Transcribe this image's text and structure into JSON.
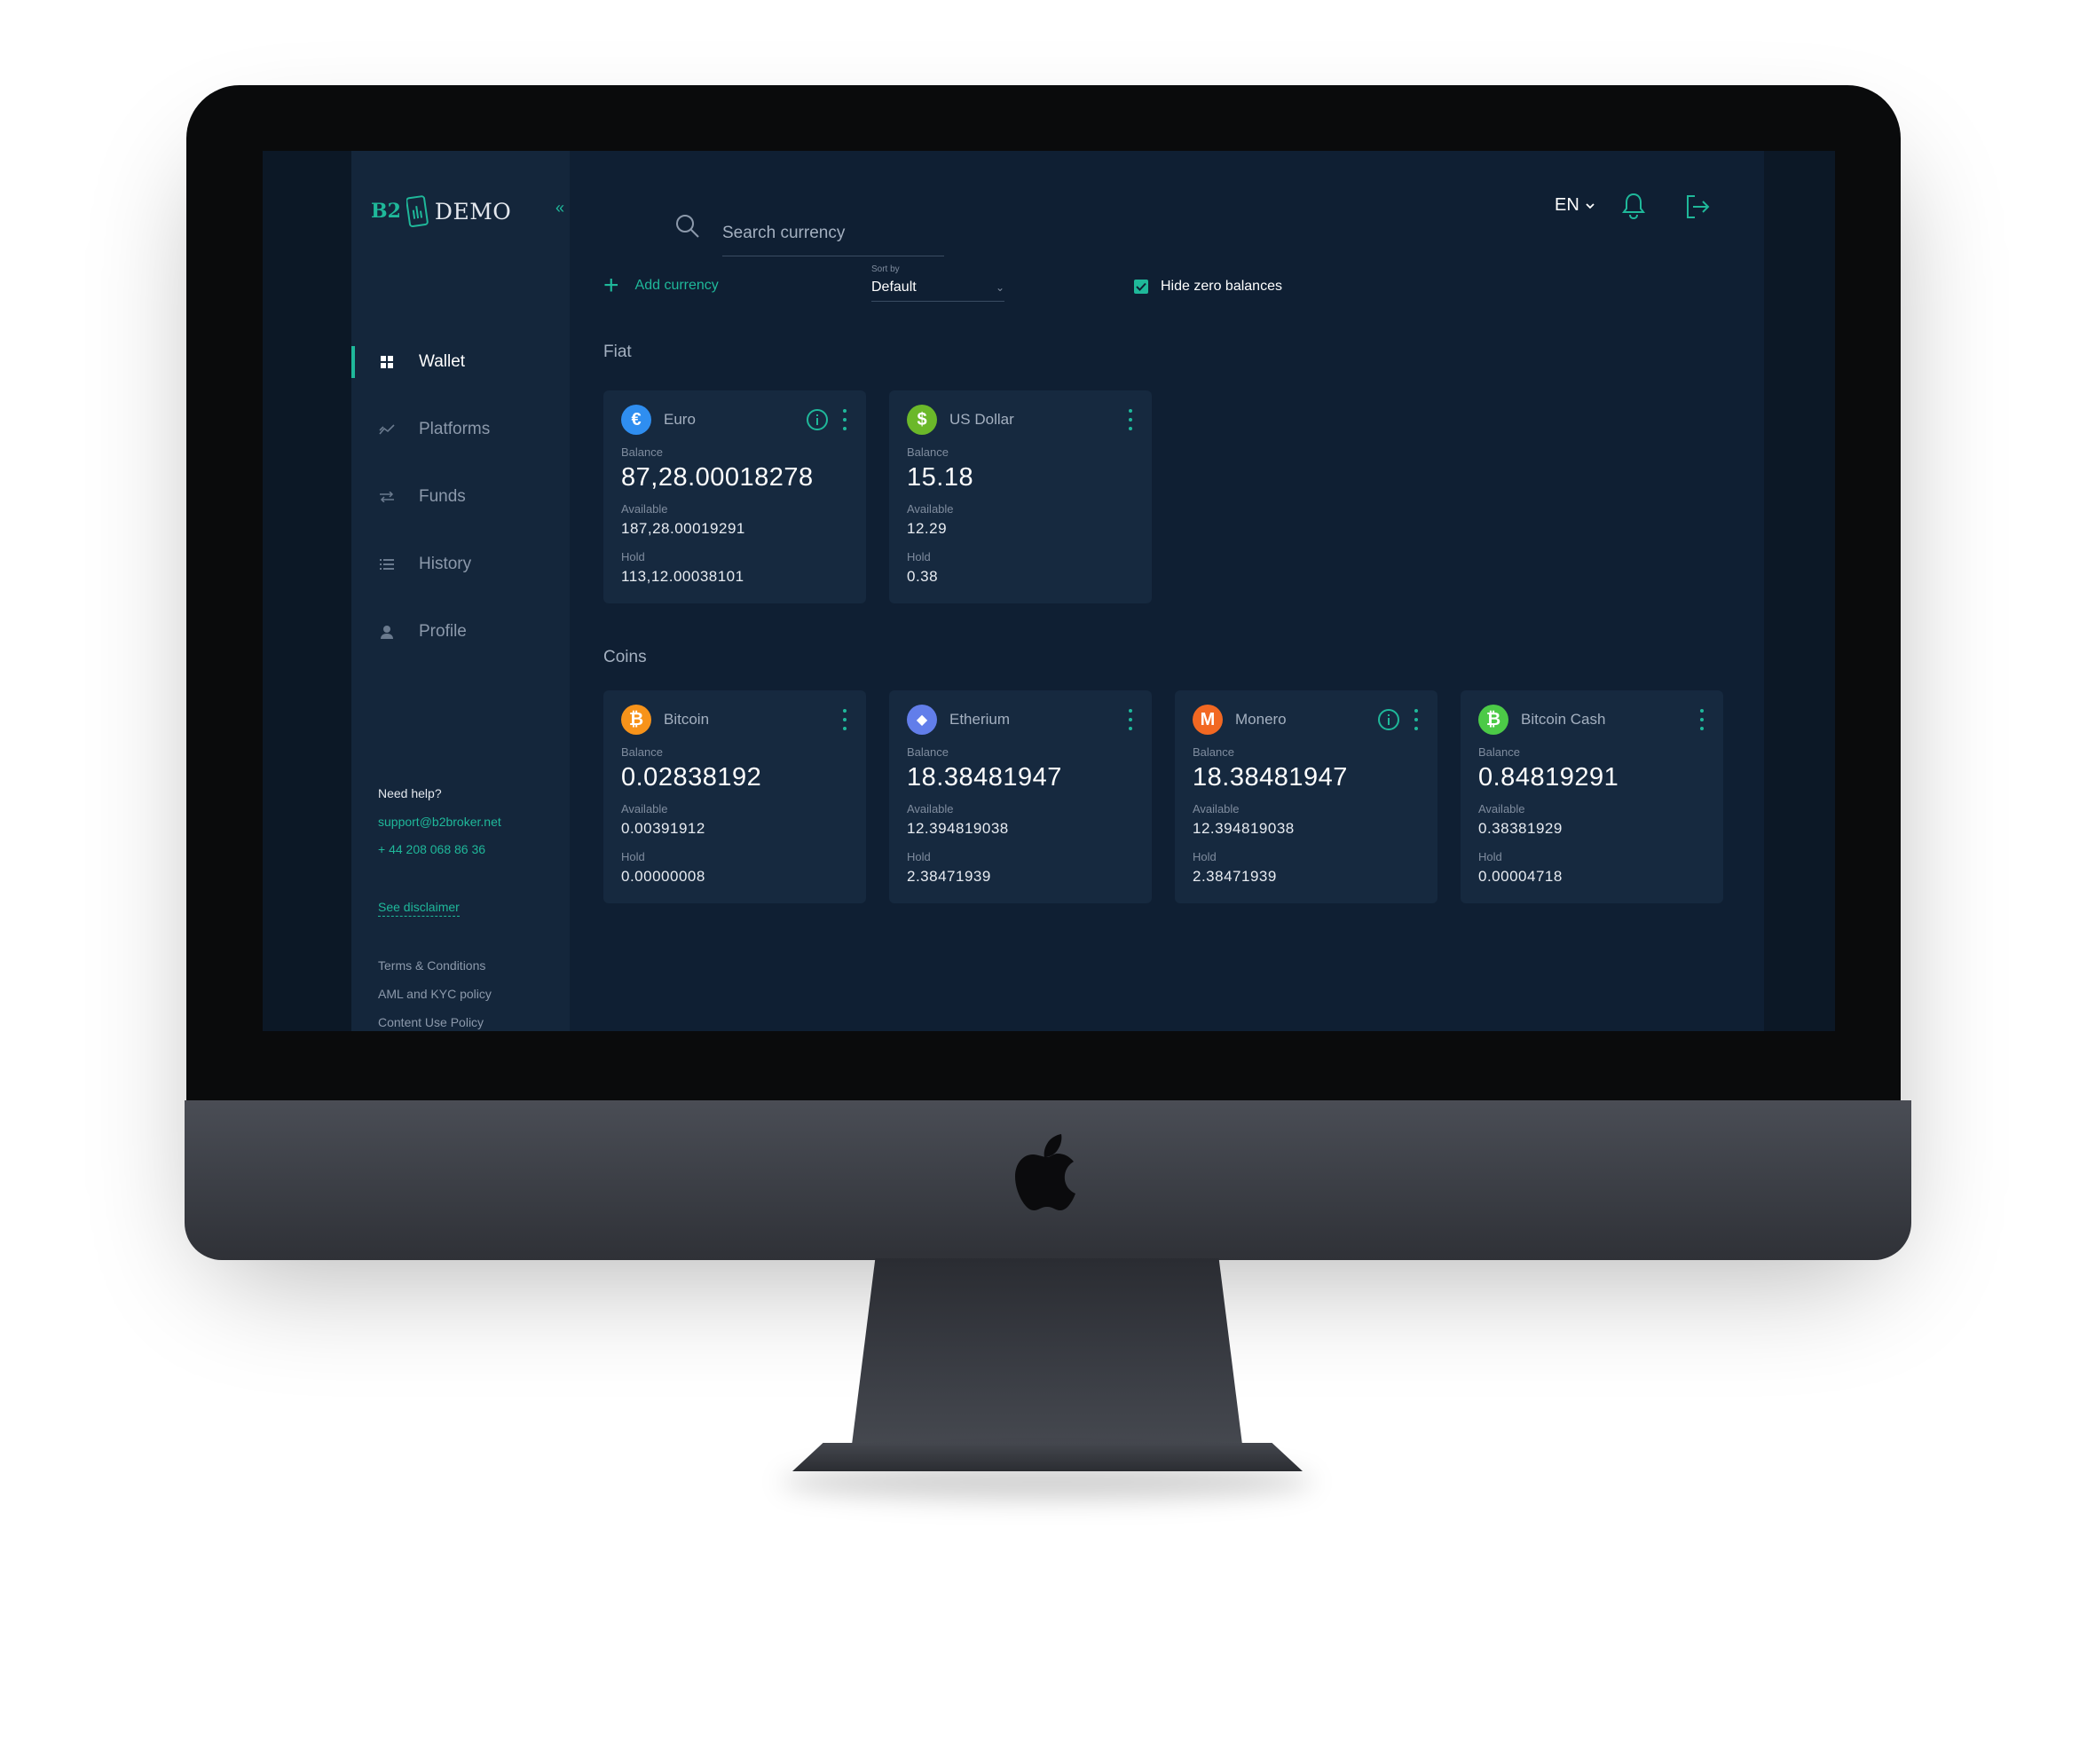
{
  "app": {
    "logo_b2": "B2",
    "logo_demo": "DEMO"
  },
  "sidebar": {
    "items": [
      {
        "label": "Wallet",
        "icon": "grid-icon",
        "active": true
      },
      {
        "label": "Platforms",
        "icon": "chart-line-icon",
        "active": false
      },
      {
        "label": "Funds",
        "icon": "transfer-arrows-icon",
        "active": false
      },
      {
        "label": "History",
        "icon": "list-icon",
        "active": false
      },
      {
        "label": "Profile",
        "icon": "user-icon",
        "active": false
      }
    ],
    "help_title": "Need help?",
    "support_email": "support@b2broker.net",
    "support_phone": "+ 44 208 068 86 36",
    "disclaimer": "See disclaimer",
    "legal": [
      "Terms & Conditions",
      "AML and KYC policy",
      "Content Use Policy"
    ]
  },
  "header": {
    "search_placeholder": "Search currency",
    "language": "EN"
  },
  "toolbar": {
    "add_currency": "Add currency",
    "sort_caption": "Sort by",
    "sort_value": "Default",
    "hide_zero_label": "Hide zero balances",
    "hide_zero_checked": true
  },
  "labels": {
    "balance": "Balance",
    "available": "Available",
    "hold": "Hold"
  },
  "fiat": {
    "title": "Fiat",
    "cards": [
      {
        "name": "Euro",
        "symbol": "€",
        "color": "#2f8ef0",
        "info": true,
        "balance": "87,28.00018278",
        "available": "187,28.00019291",
        "hold": "113,12.00038101"
      },
      {
        "name": "US Dollar",
        "symbol": "$",
        "color": "#6bb82a",
        "info": false,
        "balance": "15.18",
        "available": "12.29",
        "hold": "0.38"
      }
    ]
  },
  "coins": {
    "title": "Coins",
    "cards": [
      {
        "name": "Bitcoin",
        "symbol": "₿",
        "color": "#f7931a",
        "info": false,
        "balance": "0.02838192",
        "available": "0.00391912",
        "hold": "0.00000008"
      },
      {
        "name": "Etherium",
        "symbol": "◆",
        "color": "#627eea",
        "info": false,
        "balance": "18.38481947",
        "available": "12.394819038",
        "hold": "2.38471939"
      },
      {
        "name": "Monero",
        "symbol": "M",
        "color": "#f26822",
        "info": true,
        "balance": "18.38481947",
        "available": "12.394819038",
        "hold": "2.38471939"
      },
      {
        "name": "Bitcoin Cash",
        "symbol": "₿",
        "color": "#4cca47",
        "info": false,
        "balance": "0.84819291",
        "available": "0.38381929",
        "hold": "0.00004718"
      }
    ]
  },
  "colors": {
    "accent": "#1fb89a",
    "sidebar_bg": "#14263b",
    "main_bg": "#0f1f33",
    "card_bg": "#16293f"
  }
}
